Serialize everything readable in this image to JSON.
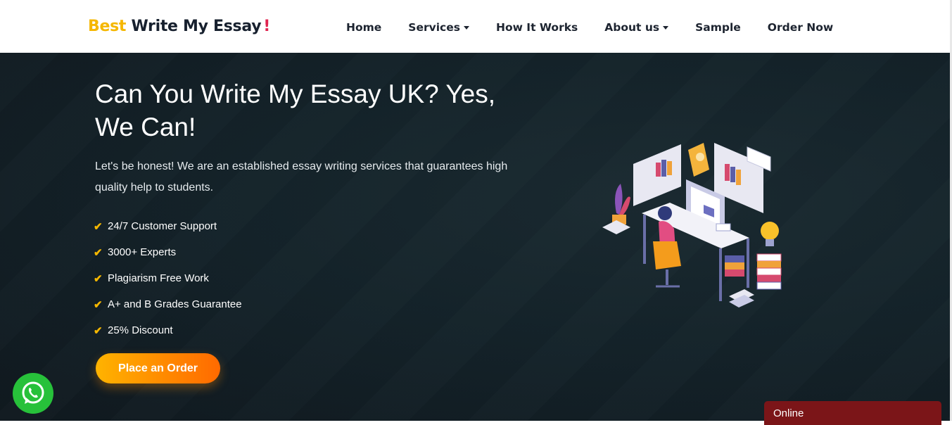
{
  "header": {
    "logo": {
      "part1": "Best",
      "part2": "Write My Essay",
      "mark": "!"
    },
    "nav": [
      {
        "label": "Home",
        "has_caret": false
      },
      {
        "label": "Services",
        "has_caret": true
      },
      {
        "label": "How It Works",
        "has_caret": false
      },
      {
        "label": "About us",
        "has_caret": true
      },
      {
        "label": "Sample",
        "has_caret": false
      },
      {
        "label": "Order Now",
        "has_caret": false
      }
    ]
  },
  "hero": {
    "title": "Can You Write My Essay UK? Yes, We Can!",
    "intro": "Let's be honest! We are an established essay writing services that guarantees high quality help to students.",
    "features": [
      "24/7 Customer Support",
      "3000+ Experts",
      "Plagiarism Free Work",
      "A+ and B Grades Guarantee",
      "25% Discount"
    ],
    "cta_label": "Place an Order",
    "illustration": "student-desk-illustration"
  },
  "widgets": {
    "whatsapp_icon": "whatsapp-icon",
    "chat_status": "Online"
  },
  "colors": {
    "brand_yellow": "#f5b700",
    "brand_dark": "#17202e",
    "logo_mark": "#e0244f",
    "hero_bg": "#14232a",
    "cta_start": "#ffb300",
    "cta_end": "#ff6a00",
    "whatsapp": "#27c13a",
    "chat_bar": "#7b1518"
  }
}
